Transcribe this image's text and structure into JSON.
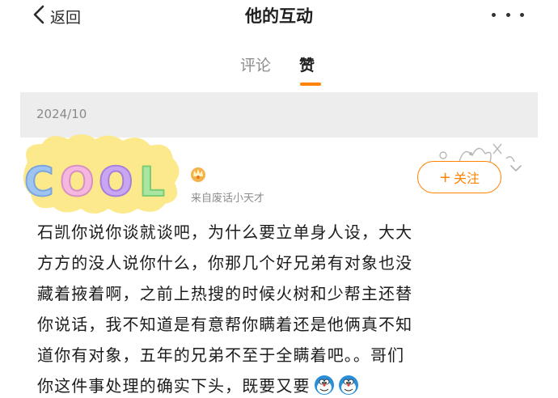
{
  "header": {
    "back_label": "返回",
    "title": "他的互动",
    "more_icon": "more-dots-icon"
  },
  "tabs": [
    {
      "label": "评论",
      "active": false
    },
    {
      "label": "赞",
      "active": true
    }
  ],
  "accent_color": "#ff8200",
  "date_header": "2024/10",
  "card": {
    "badge_icon": "cool-sticker-badge",
    "source": "来自废话小天才",
    "follow_label": "关注",
    "follow_icon": "plus-icon"
  },
  "post": {
    "lines": [
      "石凯你说你谈就谈吧，为什么要立单身人设，大大",
      "方方的没人说你什么，你那几个好兄弟有对象也没",
      "藏着掖着啊，之前上热搜的时候火树和少帮主还替",
      "你说话，我不知道是有意帮你瞒着还是他俩真不知",
      "道你有对象，五年的兄弟不至于全瞒着吧。。哥们",
      "你这件事处理的确实下头，既要又要"
    ],
    "trailing_emojis": [
      "doraemon-emoji",
      "doraemon-emoji"
    ]
  }
}
